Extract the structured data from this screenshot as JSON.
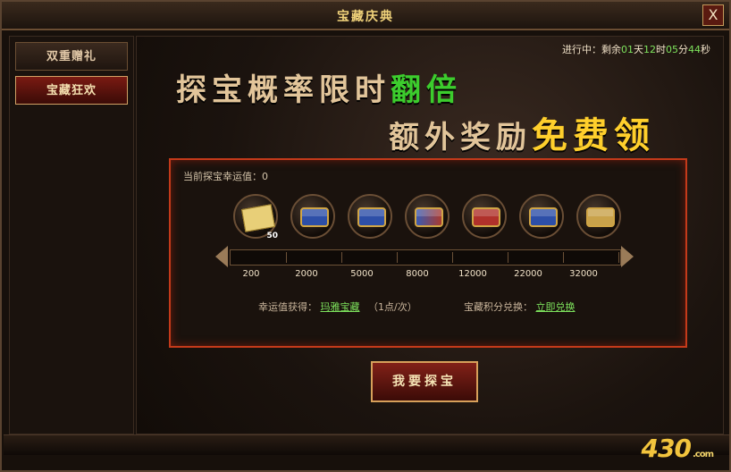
{
  "window": {
    "title": "宝藏庆典",
    "close_label": "X"
  },
  "sidebar": {
    "items": [
      {
        "label": "双重赠礼"
      },
      {
        "label": "宝藏狂欢"
      }
    ]
  },
  "main": {
    "status": {
      "prefix": "进行中：剩余",
      "days": "01",
      "days_unit": "天",
      "hours": "12",
      "hours_unit": "时",
      "minutes": "05",
      "minutes_unit": "分",
      "seconds": "44",
      "seconds_unit": "秒"
    },
    "headline_line1_main": "探宝概率限时",
    "headline_line1_emph": "翻倍",
    "headline_line2_main": "额外奖励",
    "headline_line2_emph": "免费领",
    "luck_label": "当前探宝幸运值：0",
    "rewards": [
      {
        "icon": "map-scroll-icon",
        "badge": "50"
      },
      {
        "icon": "treasure-chest-silver-icon"
      },
      {
        "icon": "treasure-chest-blue-icon"
      },
      {
        "icon": "treasure-chest-mixed-icon"
      },
      {
        "icon": "treasure-chest-red-icon"
      },
      {
        "icon": "treasure-chest-blue-gold-icon"
      },
      {
        "icon": "treasure-chest-gold-icon"
      }
    ],
    "thresholds": [
      "200",
      "2000",
      "5000",
      "8000",
      "12000",
      "22000",
      "32000"
    ],
    "luck_gain_label": "幸运值获得：",
    "luck_gain_link": "玛雅宝藏",
    "luck_gain_note": "（1点/次）",
    "points_exchange_label": "宝藏积分兑换：",
    "points_exchange_link": "立即兑换",
    "cta_label": "我要探宝"
  },
  "branding": {
    "logo_text": "430",
    "logo_suffix": ".com"
  }
}
